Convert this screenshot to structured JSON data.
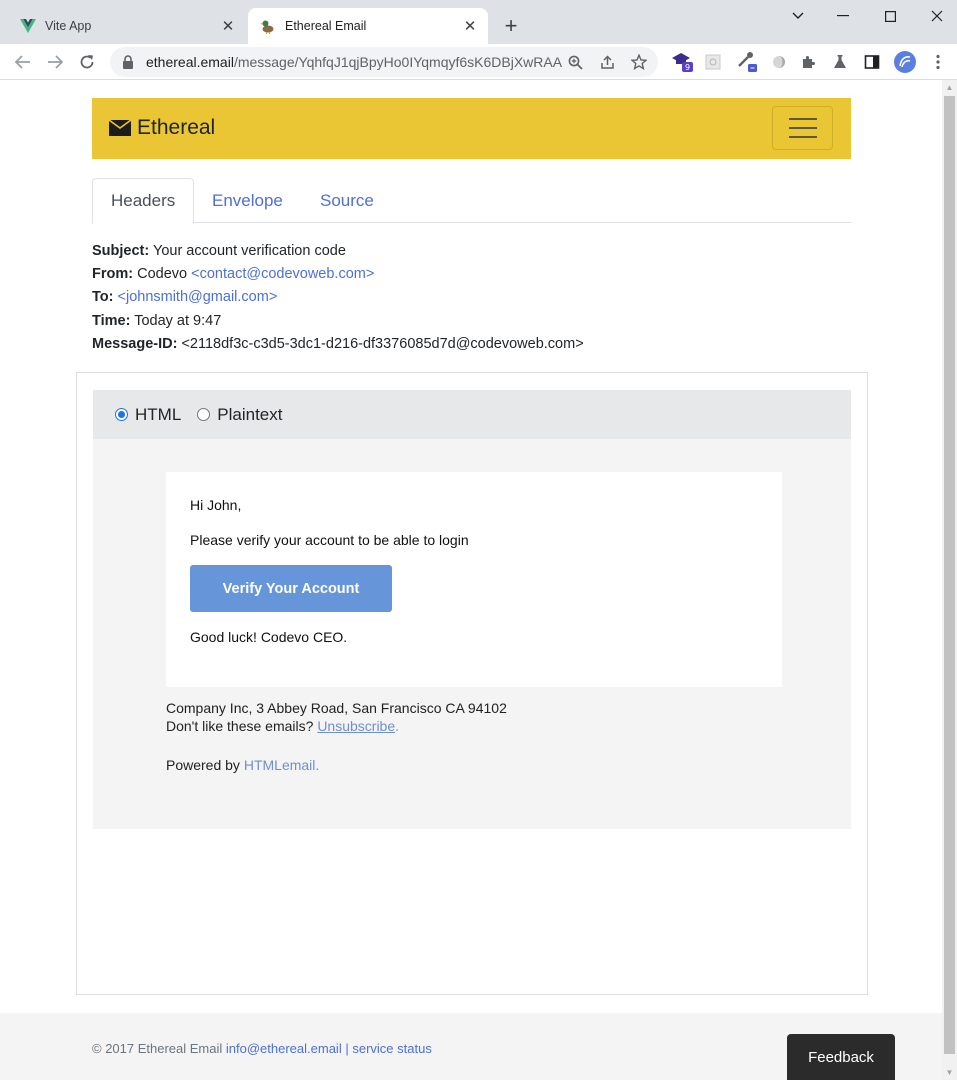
{
  "browser": {
    "tabs": [
      {
        "title": "Vite App",
        "active": false
      },
      {
        "title": "Ethereal Email",
        "active": true
      }
    ],
    "new_tab": "+",
    "url_host": "ethereal.email",
    "url_path": "/message/YqhfqJ1qjBpyHo0IYqmqyf6sK6DBjXwRAA...",
    "extension_badge": "9",
    "colors": {
      "tabbar": "#dee1e6",
      "accent": "#1a73e8"
    }
  },
  "navbar": {
    "brand": "Ethereal",
    "color": "#ebc634"
  },
  "tabs": [
    {
      "label": "Headers",
      "active": true
    },
    {
      "label": "Envelope",
      "active": false
    },
    {
      "label": "Source",
      "active": false
    }
  ],
  "headers": {
    "subject_label": "Subject:",
    "subject": "Your account verification code",
    "from_label": "From:",
    "from_name": "Codevo",
    "from_addr": "<contact@codevoweb.com>",
    "to_label": "To:",
    "to_addr": "<johnsmith@gmail.com>",
    "time_label": "Time:",
    "time": "Today at 9:47",
    "msgid_label": "Message-ID:",
    "msgid": "<2118df3c-c3d5-3dc1-d216-df3376085d7d@codevoweb.com>"
  },
  "format": {
    "options": [
      {
        "label": "HTML",
        "selected": true
      },
      {
        "label": "Plaintext",
        "selected": false
      }
    ]
  },
  "email": {
    "greeting": "Hi John,",
    "message": "Please verify your account to be able to login",
    "button": "Verify Your Account",
    "signoff": "Good luck! Codevo CEO.",
    "address": "Company Inc, 3 Abbey Road, San Francisco CA 94102",
    "unsub_prefix": "Don't like these emails?",
    "unsub_link": "Unsubscribe",
    "unsub_suffix": ".",
    "powered_prefix": "Powered by",
    "powered_link": "HTMLemail",
    "powered_suffix": "."
  },
  "footer": {
    "copyright": "© 2017 Ethereal Email",
    "email": "info@ethereal.email",
    "separator": "|",
    "status": "service status"
  },
  "feedback": "Feedback"
}
